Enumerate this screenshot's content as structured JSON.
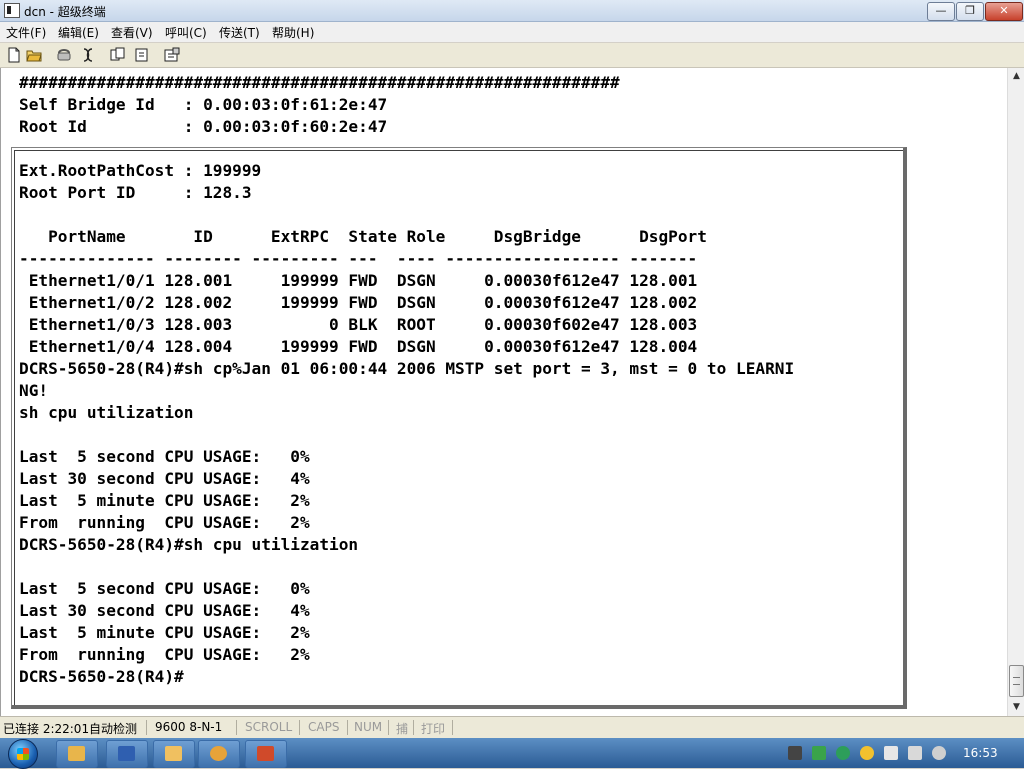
{
  "window": {
    "title": "dcn - 超级终端"
  },
  "window_controls": {
    "minimize": "—",
    "maximize": "❐",
    "close": "✕"
  },
  "menu": [
    "文件(F)",
    "编辑(E)",
    "查看(V)",
    "呼叫(C)",
    "传送(T)",
    "帮助(H)"
  ],
  "toolbar": [
    "new-icon",
    "open-icon",
    "phone-icon",
    "disconnect-icon",
    "send-icon",
    "receive-icon",
    "properties-icon"
  ],
  "terminal": {
    "lines": [
      "##############################################################",
      "Self Bridge Id   : 0.00:03:0f:61:2e:47",
      "Root Id          : 0.00:03:0f:60:2e:47",
      "",
      "Ext.RootPathCost : 199999",
      "Root Port ID     : 128.3",
      "",
      "   PortName       ID      ExtRPC  State Role     DsgBridge      DsgPort",
      "-------------- -------- --------- ---  ---- ------------------ -------",
      " Ethernet1/0/1 128.001     199999 FWD  DSGN     0.00030f612e47 128.001",
      " Ethernet1/0/2 128.002     199999 FWD  DSGN     0.00030f612e47 128.002",
      " Ethernet1/0/3 128.003          0 BLK  ROOT     0.00030f602e47 128.003",
      " Ethernet1/0/4 128.004     199999 FWD  DSGN     0.00030f612e47 128.004",
      "DCRS-5650-28(R4)#sh cp%Jan 01 06:00:44 2006 MSTP set port = 3, mst = 0 to LEARNI",
      "NG!",
      "sh cpu utilization",
      "",
      "Last  5 second CPU USAGE:   0%",
      "Last 30 second CPU USAGE:   4%",
      "Last  5 minute CPU USAGE:   2%",
      "From  running  CPU USAGE:   2%",
      "DCRS-5650-28(R4)#sh cpu utilization",
      "",
      "Last  5 second CPU USAGE:   0%",
      "Last 30 second CPU USAGE:   4%",
      "Last  5 minute CPU USAGE:   2%",
      "From  running  CPU USAGE:   2%",
      "DCRS-5650-28(R4)#"
    ]
  },
  "scrollbar": {
    "up": "▲",
    "down": "▼"
  },
  "statusbar": {
    "connection": "已连接 2:22:01",
    "detect": "自动检测",
    "settings": "9600 8-N-1",
    "scroll": "SCROLL",
    "caps": "CAPS",
    "num": "NUM",
    "capture": "捕",
    "print": "打印"
  },
  "taskbar": {
    "apps": [
      "explorer-icon",
      "word-icon",
      "library-icon",
      "paint-icon",
      "powerpoint-icon"
    ],
    "tray": [
      "network-icon",
      "battery-icon",
      "security-icon",
      "antivirus-icon",
      "usb-icon",
      "power-icon",
      "ime-icon",
      "volume-icon"
    ],
    "clock": "16:53"
  },
  "colors": {
    "accent": "#2b5b94",
    "terminal_bg": "#ffffff",
    "terminal_text": "#000000"
  }
}
